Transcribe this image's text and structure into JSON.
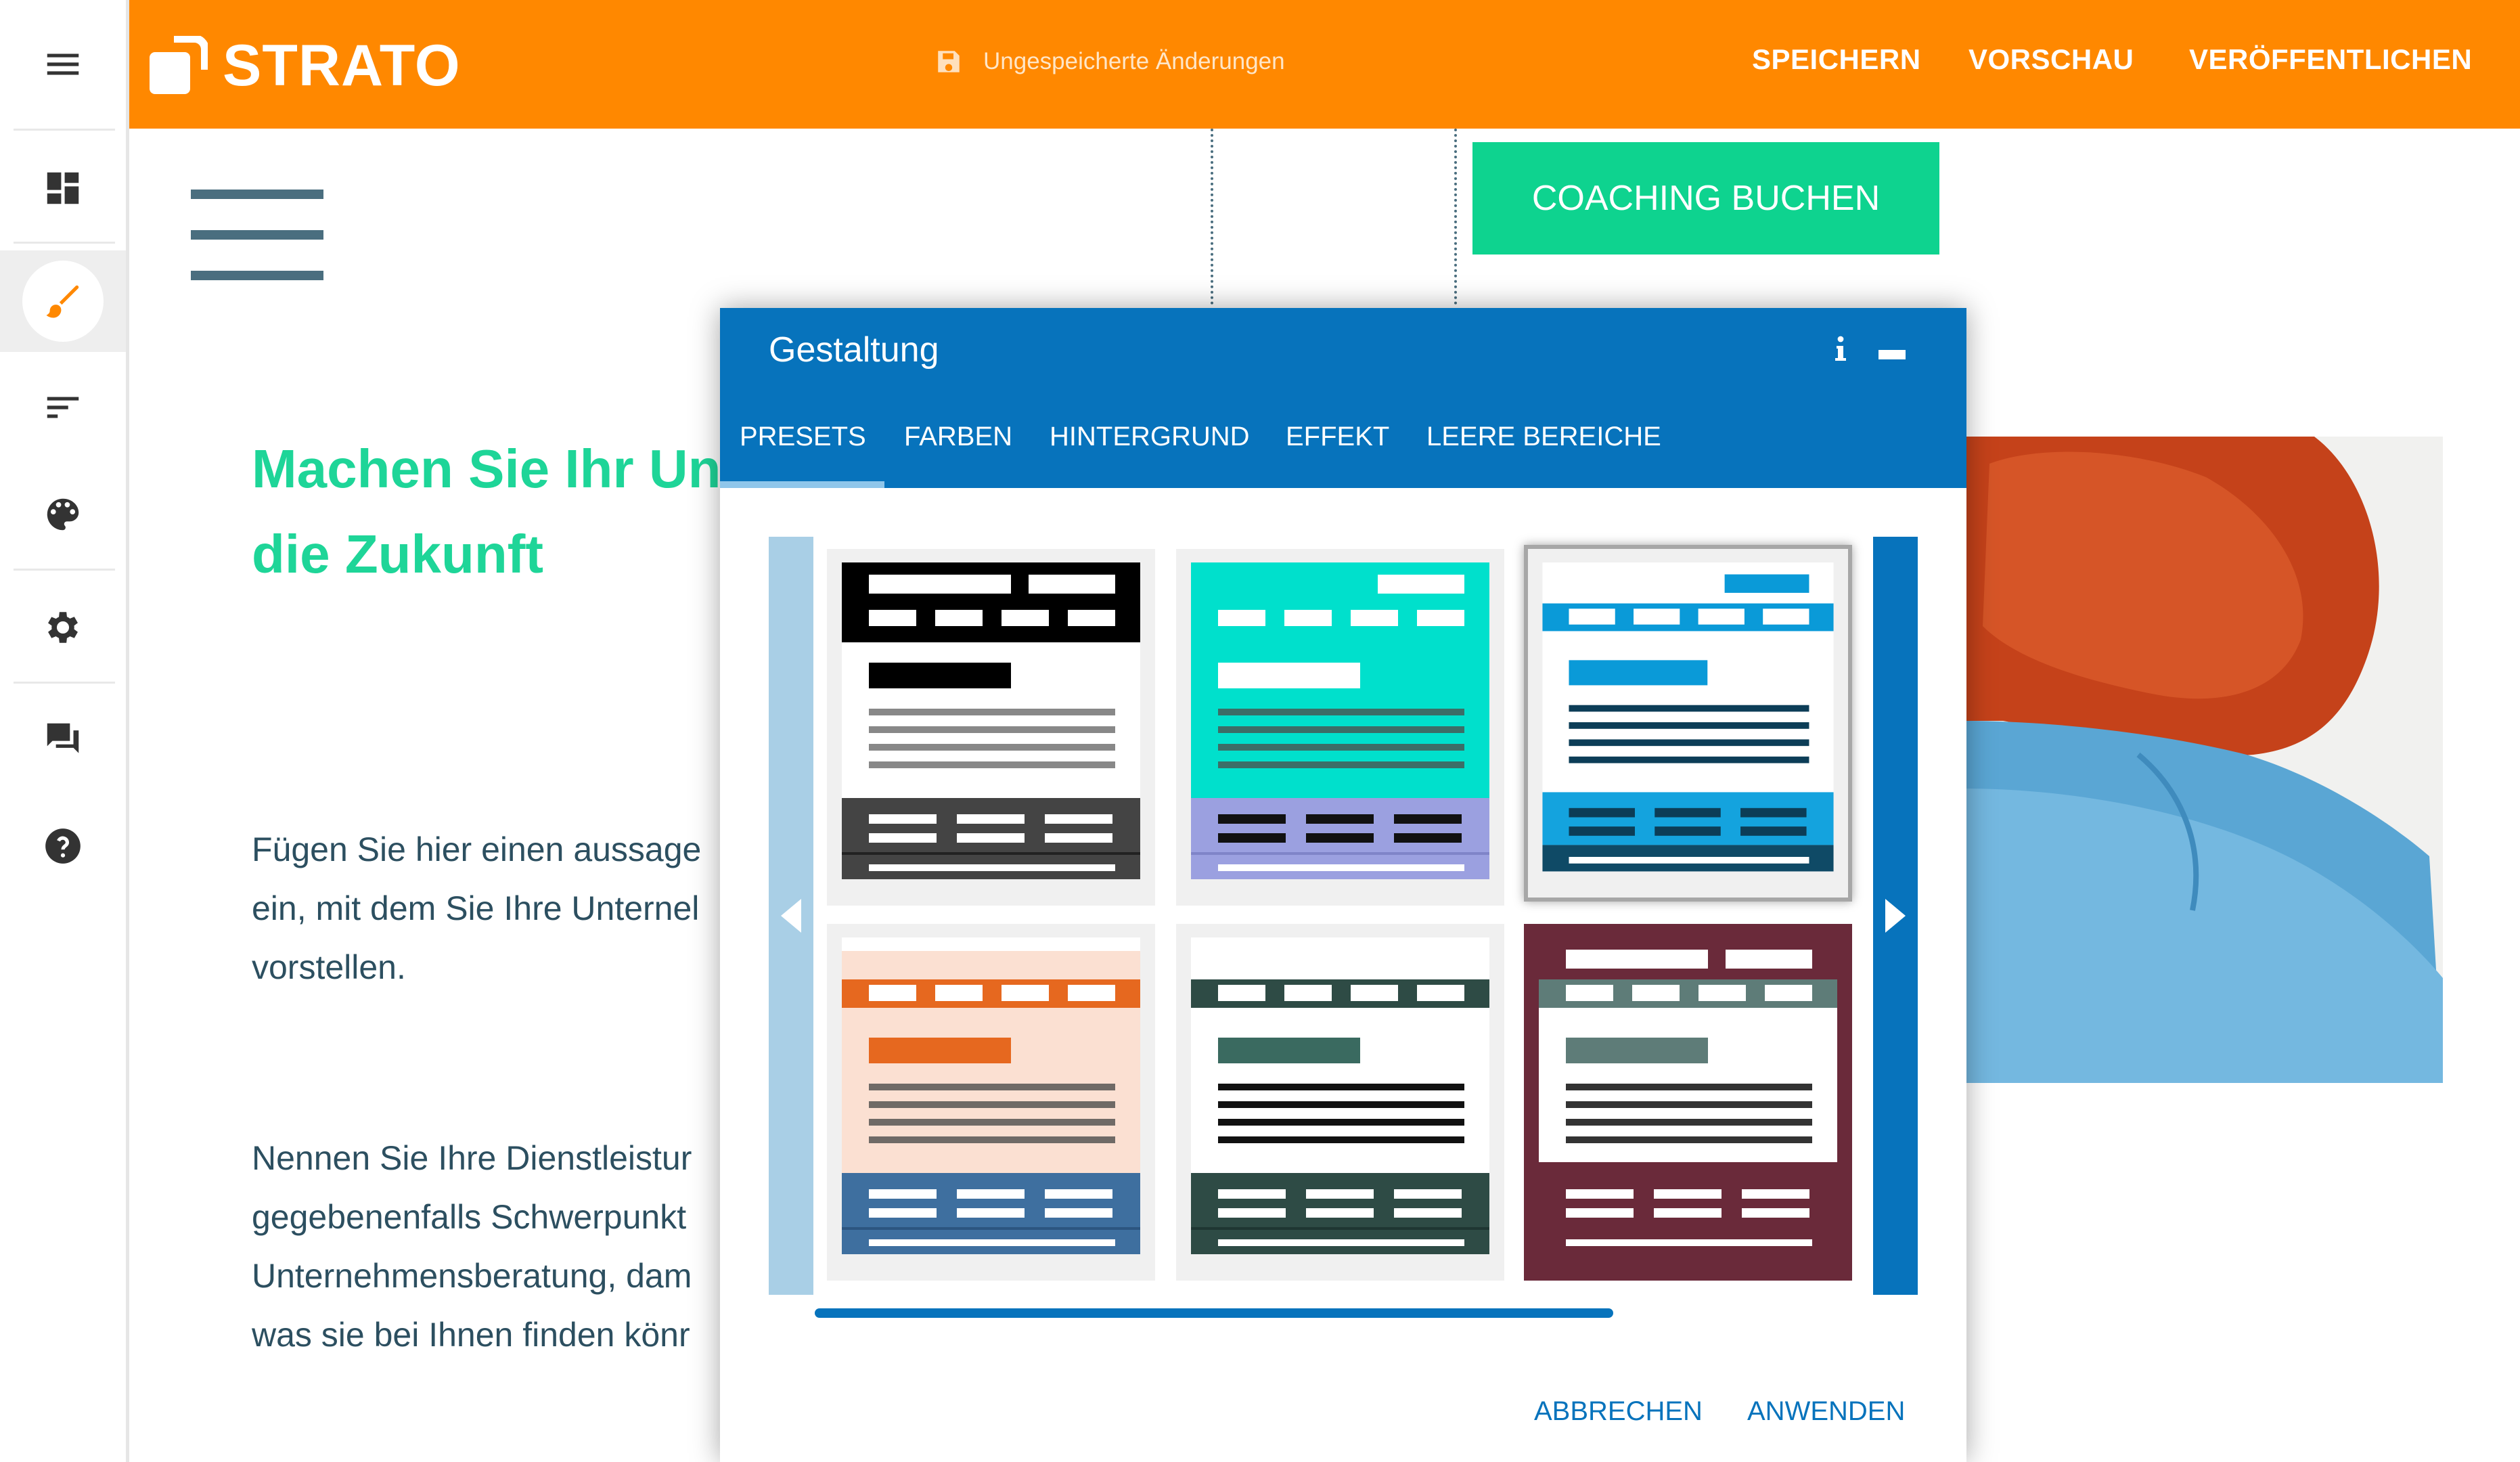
{
  "sidebar": {
    "items": [
      {
        "name": "menu-icon"
      },
      {
        "name": "dashboard-icon"
      },
      {
        "name": "brush-icon",
        "active": true
      },
      {
        "name": "sort-lines-icon"
      },
      {
        "name": "palette-icon"
      },
      {
        "name": "settings-gear-icon"
      },
      {
        "name": "chat-icon"
      },
      {
        "name": "help-icon"
      }
    ]
  },
  "topbar": {
    "logo_text": "STRATO",
    "unsaved_text": "Ungespeicherte Änderungen",
    "save_label": "SPEICHERN",
    "preview_label": "VORSCHAU",
    "publish_label": "VERÖFFENTLICHEN"
  },
  "page": {
    "coaching_button": "COACHING BUCHEN",
    "headline_line1": "Machen Sie Ihr Un",
    "headline_line2": "die Zukunft",
    "para1": [
      "Fügen Sie hier einen aussage",
      "ein, mit dem Sie Ihre Unternel",
      "vorstellen."
    ],
    "para2": [
      "Nennen Sie Ihre Dienstleistur",
      "gegebenenfalls Schwerpunkt",
      "Unternehmensberatung, dam",
      "was sie bei Ihnen finden könr"
    ]
  },
  "modal": {
    "title": "Gestaltung",
    "tabs": [
      "PRESETS",
      "FARBEN",
      "HINTERGRUND",
      "EFFEKT",
      "LEERE BEREICHE"
    ],
    "active_tab": "PRESETS",
    "presets": [
      {
        "name": "preset-black",
        "selected": false
      },
      {
        "name": "preset-turquoise",
        "selected": false
      },
      {
        "name": "preset-blue",
        "selected": true
      },
      {
        "name": "preset-orange",
        "selected": false
      },
      {
        "name": "preset-dark-green",
        "selected": false
      },
      {
        "name": "preset-burgundy",
        "selected": false
      }
    ],
    "cancel_label": "ABBRECHEN",
    "apply_label": "ANWENDEN"
  },
  "colors": {
    "brand_orange": "#ff8800",
    "modal_blue": "#0773bc",
    "accent_green": "#0ed38f",
    "text_teal": "#2c4f60"
  }
}
